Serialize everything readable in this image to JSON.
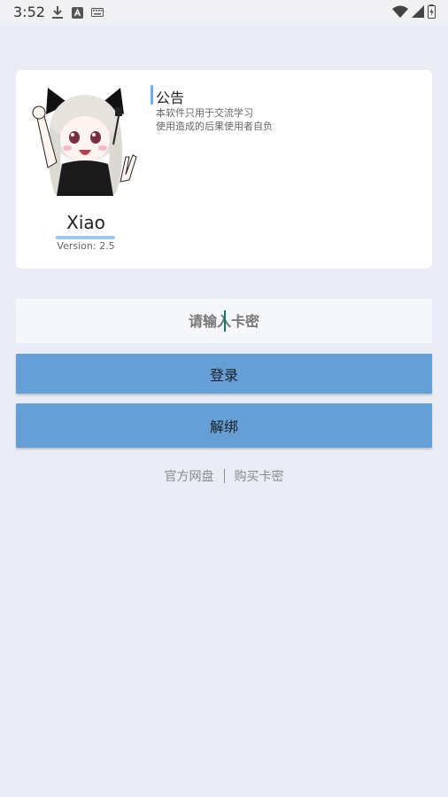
{
  "status_bar": {
    "time": "3:52",
    "icons_left": [
      "download-icon",
      "a-icon",
      "keyboard-icon"
    ],
    "icons_right": [
      "wifi-icon",
      "signal-icon",
      "battery-charging-icon"
    ]
  },
  "card": {
    "app_name": "Xiao",
    "version": "Version: 2.5",
    "notice_title": "公告",
    "notice_lines": [
      "本软件只用于交流学习",
      "使用造成的后果使用者自负"
    ]
  },
  "input": {
    "placeholder": "请输入卡密",
    "value": ""
  },
  "buttons": {
    "login": "登录",
    "unbind": "解绑"
  },
  "links": {
    "netdisk": "官方网盘",
    "buy": "购买卡密"
  },
  "colors": {
    "background": "#eaedf5",
    "button": "#659fd6",
    "accent": "#6ab0f3",
    "underline": "#9ec8f2"
  }
}
